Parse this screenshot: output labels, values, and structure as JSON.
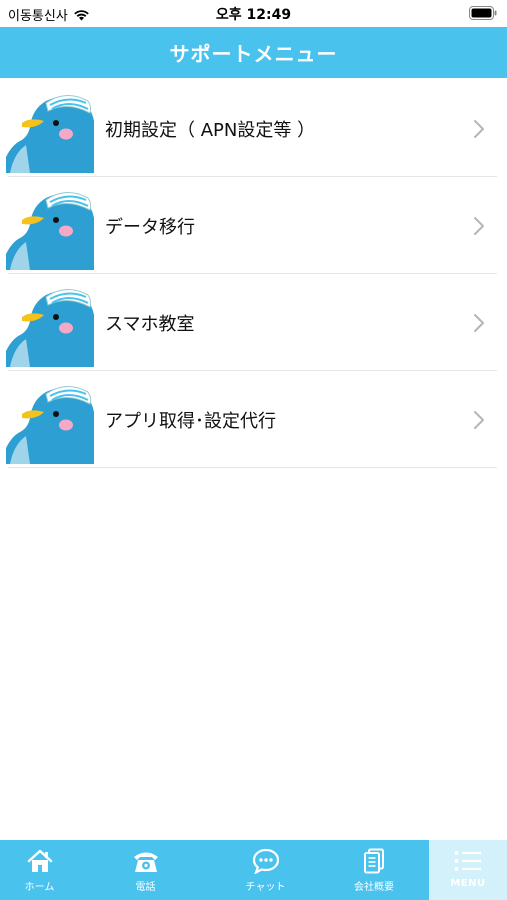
{
  "status_bar": {
    "carrier": "이동통신사",
    "time": "오후 12:49"
  },
  "header": {
    "title": "サポートメニュー"
  },
  "menu": {
    "items": [
      {
        "label": "初期設定（ APN設定等 ）"
      },
      {
        "label": "データ移行"
      },
      {
        "label": "スマホ教室"
      },
      {
        "label": "アプリ取得･設定代行"
      }
    ]
  },
  "tab_bar": {
    "tabs": [
      {
        "label": "ホーム",
        "icon": "home-icon"
      },
      {
        "label": "電話",
        "icon": "phone-icon"
      },
      {
        "label": "チャット",
        "icon": "chat-icon"
      },
      {
        "label": "会社概要",
        "icon": "document-icon"
      },
      {
        "label": "MENU",
        "icon": "menu-list-icon"
      }
    ],
    "active": "MENU"
  },
  "colors": {
    "accent": "#4ac2ee",
    "active_tab": "#d3f1fb",
    "mascot_body": "#2d9fd3",
    "mascot_beak": "#f4c21b",
    "mascot_cheek": "#f6a9c6"
  }
}
